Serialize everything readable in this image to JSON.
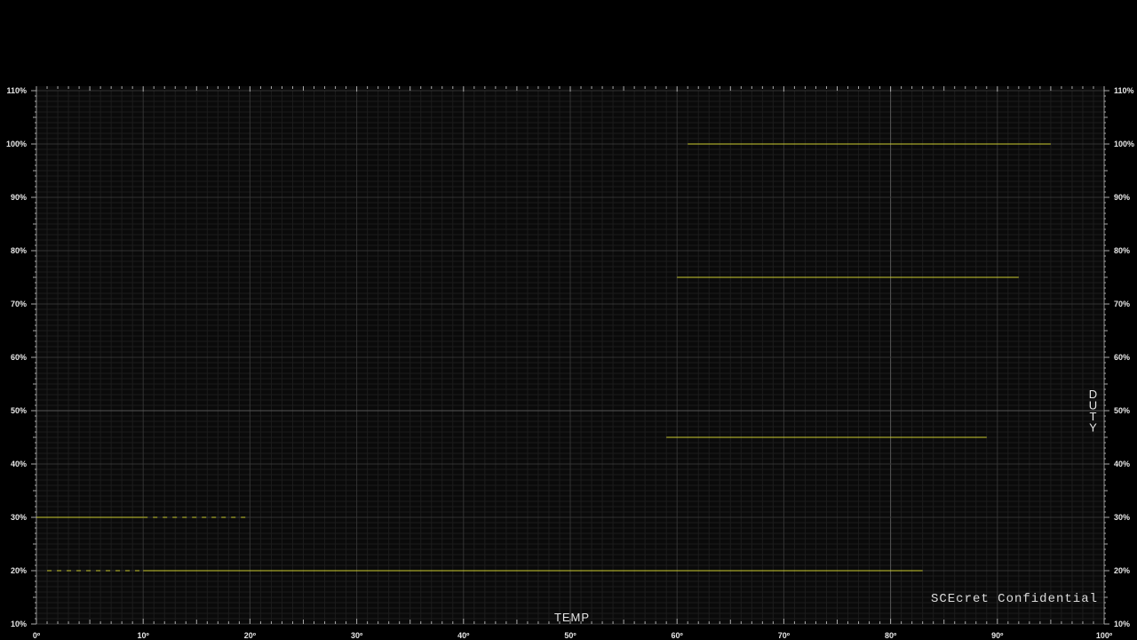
{
  "colors": {
    "background": "#000000",
    "line": "#cccc33",
    "grid_minor": "#1c1c1c",
    "grid_major": "#333333",
    "grid_strong": "#555555",
    "text": "#e6e6e6"
  },
  "chart_data": {
    "type": "line",
    "title": "",
    "xlabel": "TEMP",
    "ylabel": "DUTY",
    "xlim": [
      0,
      100
    ],
    "ylim": [
      10,
      110
    ],
    "x_ticks": [
      "0º",
      "10º",
      "20º",
      "30º",
      "40º",
      "50º",
      "60º",
      "70º",
      "80º",
      "90º",
      "100º"
    ],
    "y_ticks": [
      "10%",
      "20%",
      "30%",
      "40%",
      "50%",
      "60%",
      "70%",
      "80%",
      "90%",
      "100%",
      "110%"
    ],
    "grid": true,
    "series": [
      {
        "style": "solid",
        "points": [
          [
            0,
            30
          ],
          [
            10,
            30
          ]
        ]
      },
      {
        "style": "dashed",
        "points": [
          [
            10,
            30
          ],
          [
            20,
            30
          ]
        ]
      },
      {
        "style": "dashed",
        "points": [
          [
            1,
            20
          ],
          [
            10,
            20
          ]
        ]
      },
      {
        "style": "solid",
        "points": [
          [
            10,
            20
          ],
          [
            83,
            20
          ]
        ]
      },
      {
        "style": "solid",
        "points": [
          [
            59,
            45
          ],
          [
            89,
            45
          ]
        ]
      },
      {
        "style": "solid",
        "points": [
          [
            60,
            75
          ],
          [
            92,
            75
          ]
        ]
      },
      {
        "style": "solid",
        "points": [
          [
            61,
            100
          ],
          [
            95,
            100
          ]
        ]
      }
    ],
    "annotations": [
      "SCEcret Confidential"
    ]
  }
}
